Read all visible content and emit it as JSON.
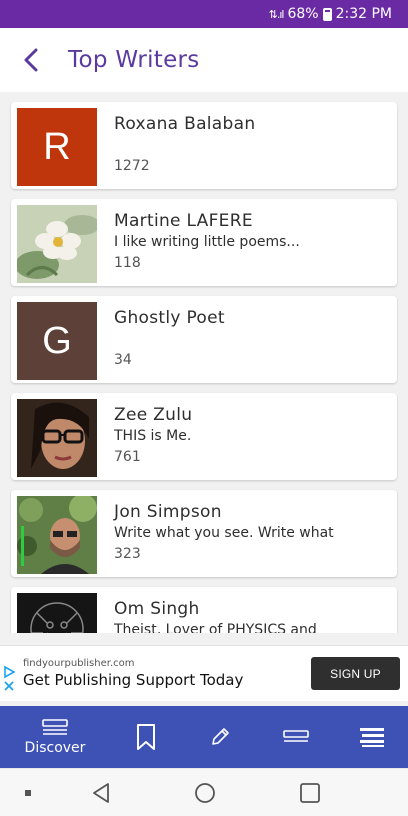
{
  "status_bar": {
    "battery": "68%",
    "time": "2:32 PM"
  },
  "header": {
    "title": "Top Writers"
  },
  "writers": [
    {
      "name": "Roxana Balaban",
      "bio": "",
      "count": "1272",
      "avatar_letter": "R",
      "avatar_color": "#bf360c"
    },
    {
      "name": "Martine LAFERE",
      "bio": "I like writing little poems...",
      "count": "118",
      "avatar_letter": "",
      "avatar_color": "#c9d4b8"
    },
    {
      "name": "Ghostly Poet",
      "bio": "",
      "count": "34",
      "avatar_letter": "G",
      "avatar_color": "#5d4037"
    },
    {
      "name": "Zee Zulu",
      "bio": "THIS is Me.",
      "count": "761",
      "avatar_letter": "",
      "avatar_color": "#3a2a22"
    },
    {
      "name": "Jon Simpson",
      "bio": "Write what you see.  Write what",
      "count": "323",
      "avatar_letter": "",
      "avatar_color": "#4a6a3a"
    },
    {
      "name": "Om Singh",
      "bio": "Theist, Lover of PHYSICS and",
      "count": "",
      "avatar_letter": "",
      "avatar_color": "#1a1a1a"
    }
  ],
  "ad": {
    "domain": "findyourpublisher.com",
    "headline": "Get Publishing Support Today",
    "cta": "SIGN UP"
  },
  "bottom_nav": {
    "discover_label": "Discover"
  },
  "colors": {
    "status_bar": "#6a2aa3",
    "title": "#5a3a9f",
    "bottom_nav": "#3e52b5"
  }
}
